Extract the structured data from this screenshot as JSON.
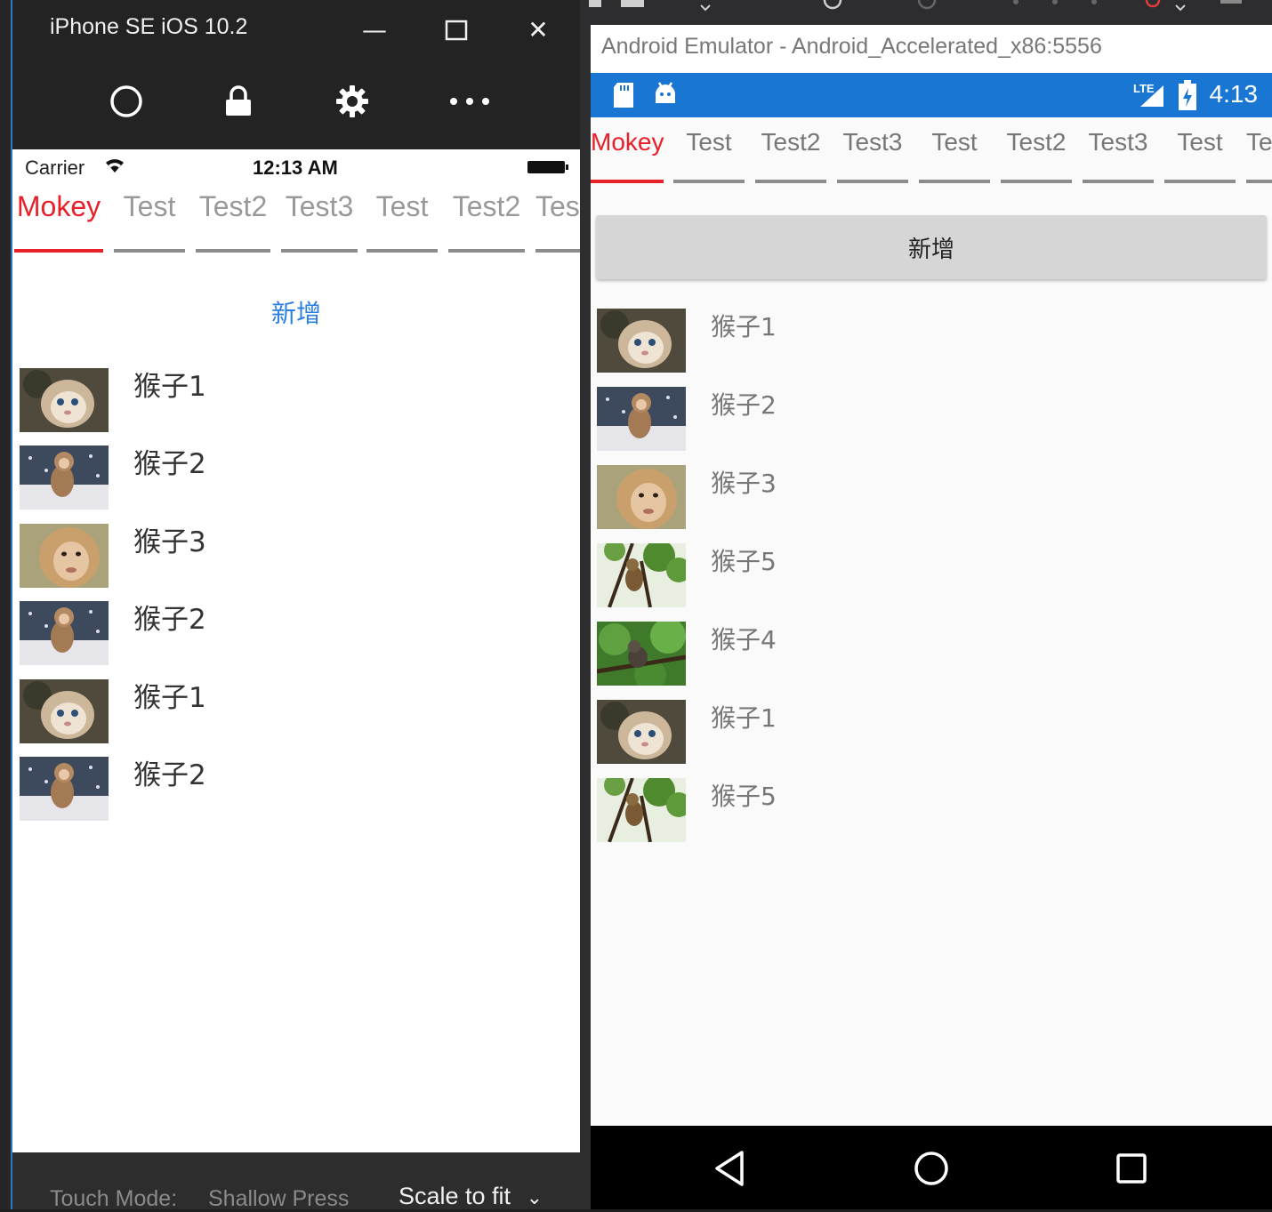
{
  "ios": {
    "window_title": "iPhone SE iOS 10.2",
    "window_controls": {
      "minimize": "—",
      "maximize": "☐",
      "close": "✕"
    },
    "toolbar_icons": [
      "home-icon",
      "lock-icon",
      "settings-icon",
      "more-icon"
    ],
    "status": {
      "carrier": "Carrier",
      "time": "12:13 AM"
    },
    "tabs": [
      {
        "label": "Mokey",
        "active": true
      },
      {
        "label": "Test",
        "active": false
      },
      {
        "label": "Test2",
        "active": false
      },
      {
        "label": "Test3",
        "active": false
      },
      {
        "label": "Test",
        "active": false
      },
      {
        "label": "Test2",
        "active": false
      },
      {
        "label": "Tes",
        "active": false
      }
    ],
    "add_button": "新增",
    "list": [
      {
        "name": "猴子1",
        "thumb": "monkey-1"
      },
      {
        "name": "猴子2",
        "thumb": "monkey-2"
      },
      {
        "name": "猴子3",
        "thumb": "monkey-3"
      },
      {
        "name": "猴子2",
        "thumb": "monkey-2"
      },
      {
        "name": "猴子1",
        "thumb": "monkey-1"
      },
      {
        "name": "猴子2",
        "thumb": "monkey-2"
      }
    ],
    "bottom": {
      "touch_mode_label": "Touch Mode:",
      "touch_mode_value": "Shallow Press",
      "scale": "Scale to fit",
      "scale_chevron": "⌄"
    }
  },
  "android": {
    "window_title": "Android Emulator - Android_Accelerated_x86:5556",
    "status": {
      "network": "LTE",
      "time": "4:13"
    },
    "tabs": [
      {
        "label": "Mokey",
        "active": true
      },
      {
        "label": "Test",
        "active": false
      },
      {
        "label": "Test2",
        "active": false
      },
      {
        "label": "Test3",
        "active": false
      },
      {
        "label": "Test",
        "active": false
      },
      {
        "label": "Test2",
        "active": false
      },
      {
        "label": "Test3",
        "active": false
      },
      {
        "label": "Test",
        "active": false
      },
      {
        "label": "Te",
        "active": false
      }
    ],
    "add_button": "新增",
    "list": [
      {
        "name": "猴子1",
        "thumb": "monkey-1"
      },
      {
        "name": "猴子2",
        "thumb": "monkey-2"
      },
      {
        "name": "猴子3",
        "thumb": "monkey-3"
      },
      {
        "name": "猴子5",
        "thumb": "monkey-5"
      },
      {
        "name": "猴子4",
        "thumb": "monkey-4"
      },
      {
        "name": "猴子1",
        "thumb": "monkey-1"
      },
      {
        "name": "猴子5",
        "thumb": "monkey-5"
      }
    ],
    "nav_icons": [
      "back-icon",
      "home-icon",
      "recents-icon"
    ]
  },
  "colors": {
    "accent_red": "#e8202a",
    "ios_link_blue": "#2a7fe0",
    "android_status_blue": "#1976d2",
    "tab_underline_gray": "#8c8c8c"
  }
}
